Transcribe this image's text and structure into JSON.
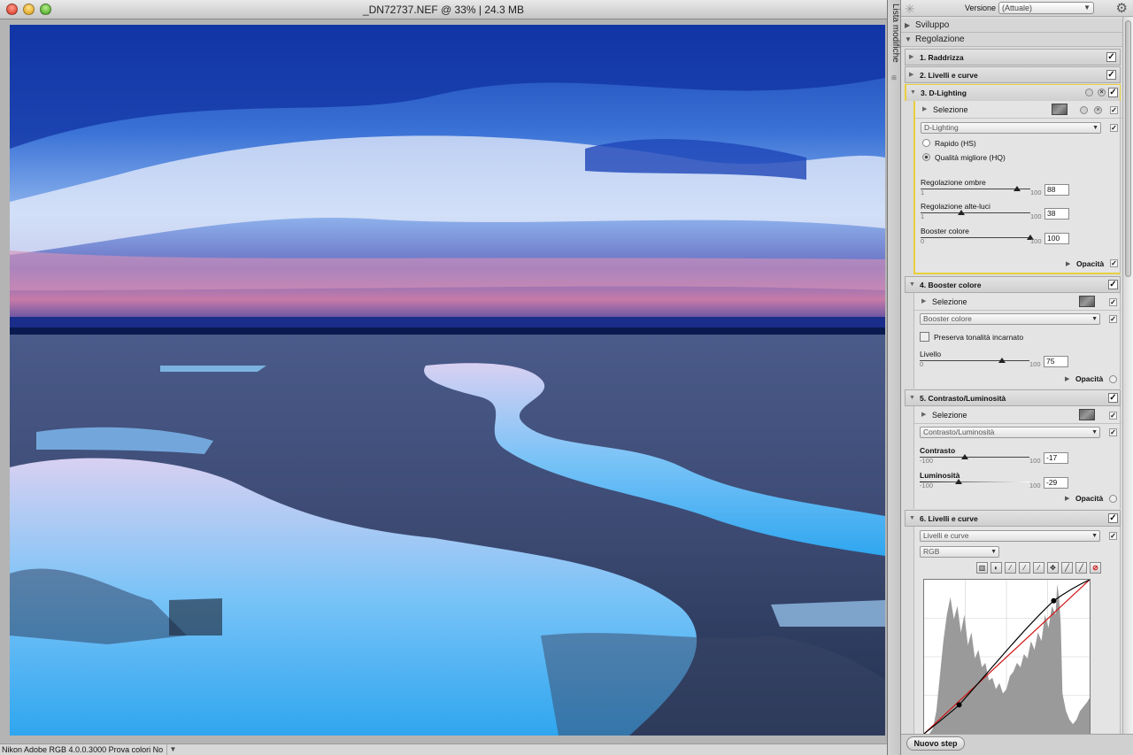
{
  "window": {
    "title": "_DN72737.NEF @ 33% | 24.3 MB"
  },
  "status_bar": {
    "profile_text": "Nikon Adobe RGB 4.0.0.3000  Prova colori No"
  },
  "side_tab": {
    "label": "Lista modifiche"
  },
  "panel": {
    "version_label": "Versione",
    "version_value": "(Attuale)",
    "sections": {
      "sviluppo": "Sviluppo",
      "regolazione": "Regolazione"
    },
    "steps": {
      "s1": "1. Raddrizza",
      "s2": "2. Livelli e curve",
      "s3": "3. D-Lighting",
      "s4": "4. Booster colore",
      "s5": "5. Contrasto/Luminosità",
      "s6": "6. Livelli e curve"
    },
    "selection_label": "Selezione",
    "opacity_label": "Opacità",
    "new_step_label": "Nuovo step",
    "dlighting": {
      "method": "D-Lighting",
      "option_fast": "Rapido (HS)",
      "option_quality": "Qualità migliore (HQ)",
      "shadows_label": "Regolazione ombre",
      "shadows_value": "88",
      "highlights_label": "Regolazione alte-luci",
      "highlights_value": "38",
      "booster_label": "Booster colore",
      "booster_value": "100",
      "min1": "1",
      "min0": "0",
      "max100": "100"
    },
    "booster": {
      "method": "Booster colore",
      "preserve_label": "Preserva tonalità incarnato",
      "level_label": "Livello",
      "level_value": "75",
      "min": "0",
      "max": "100"
    },
    "contrast": {
      "method": "Contrasto/Luminosità",
      "contrast_label": "Contrasto",
      "contrast_value": "-17",
      "brightness_label": "Luminosità",
      "brightness_value": "-29",
      "min": "-100",
      "max": "100"
    },
    "levels": {
      "method": "Livelli e curve",
      "channel": "RGB"
    }
  },
  "slider_levels": {
    "shadows": 88,
    "highlights": 38,
    "booster": 100,
    "level": 75,
    "contrast": -17,
    "brightness": -29
  },
  "colors": {
    "accent_step": "#e9cf3c",
    "curve_black": "#000000",
    "curve_red": "#d01010"
  }
}
